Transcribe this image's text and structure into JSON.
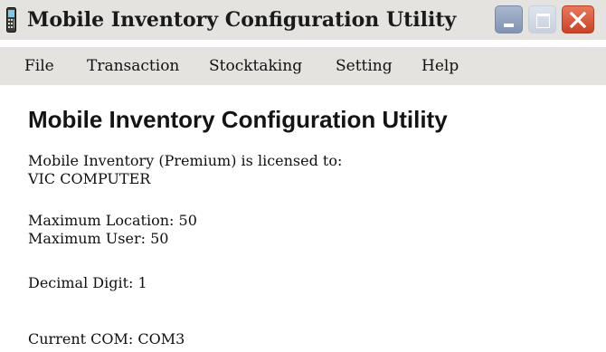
{
  "window": {
    "title": "Mobile Inventory Configuration Utility",
    "app_icon": "mobile-device-icon",
    "controls": {
      "minimize_icon": "minimize-icon",
      "maximize_icon": "maximize-icon",
      "close_icon": "close-icon"
    }
  },
  "menu": {
    "items": [
      {
        "label": "File"
      },
      {
        "label": "Transaction"
      },
      {
        "label": "Stocktaking"
      },
      {
        "label": "Setting"
      },
      {
        "label": "Help"
      }
    ]
  },
  "main": {
    "heading": "Mobile Inventory Configuration Utility",
    "license_line": "Mobile Inventory (Premium)  is licensed to:",
    "licensee": "VIC COMPUTER",
    "max_location": "Maximum Location: 50",
    "max_user": "Maximum User: 50",
    "decimal_digit": "Decimal Digit: 1",
    "current_com": "Current COM: COM3"
  },
  "colors": {
    "chrome": "#e4e3df",
    "close_button": "#d35a3c",
    "minimize_button": "#8b9cbb",
    "background": "#ffffff"
  }
}
